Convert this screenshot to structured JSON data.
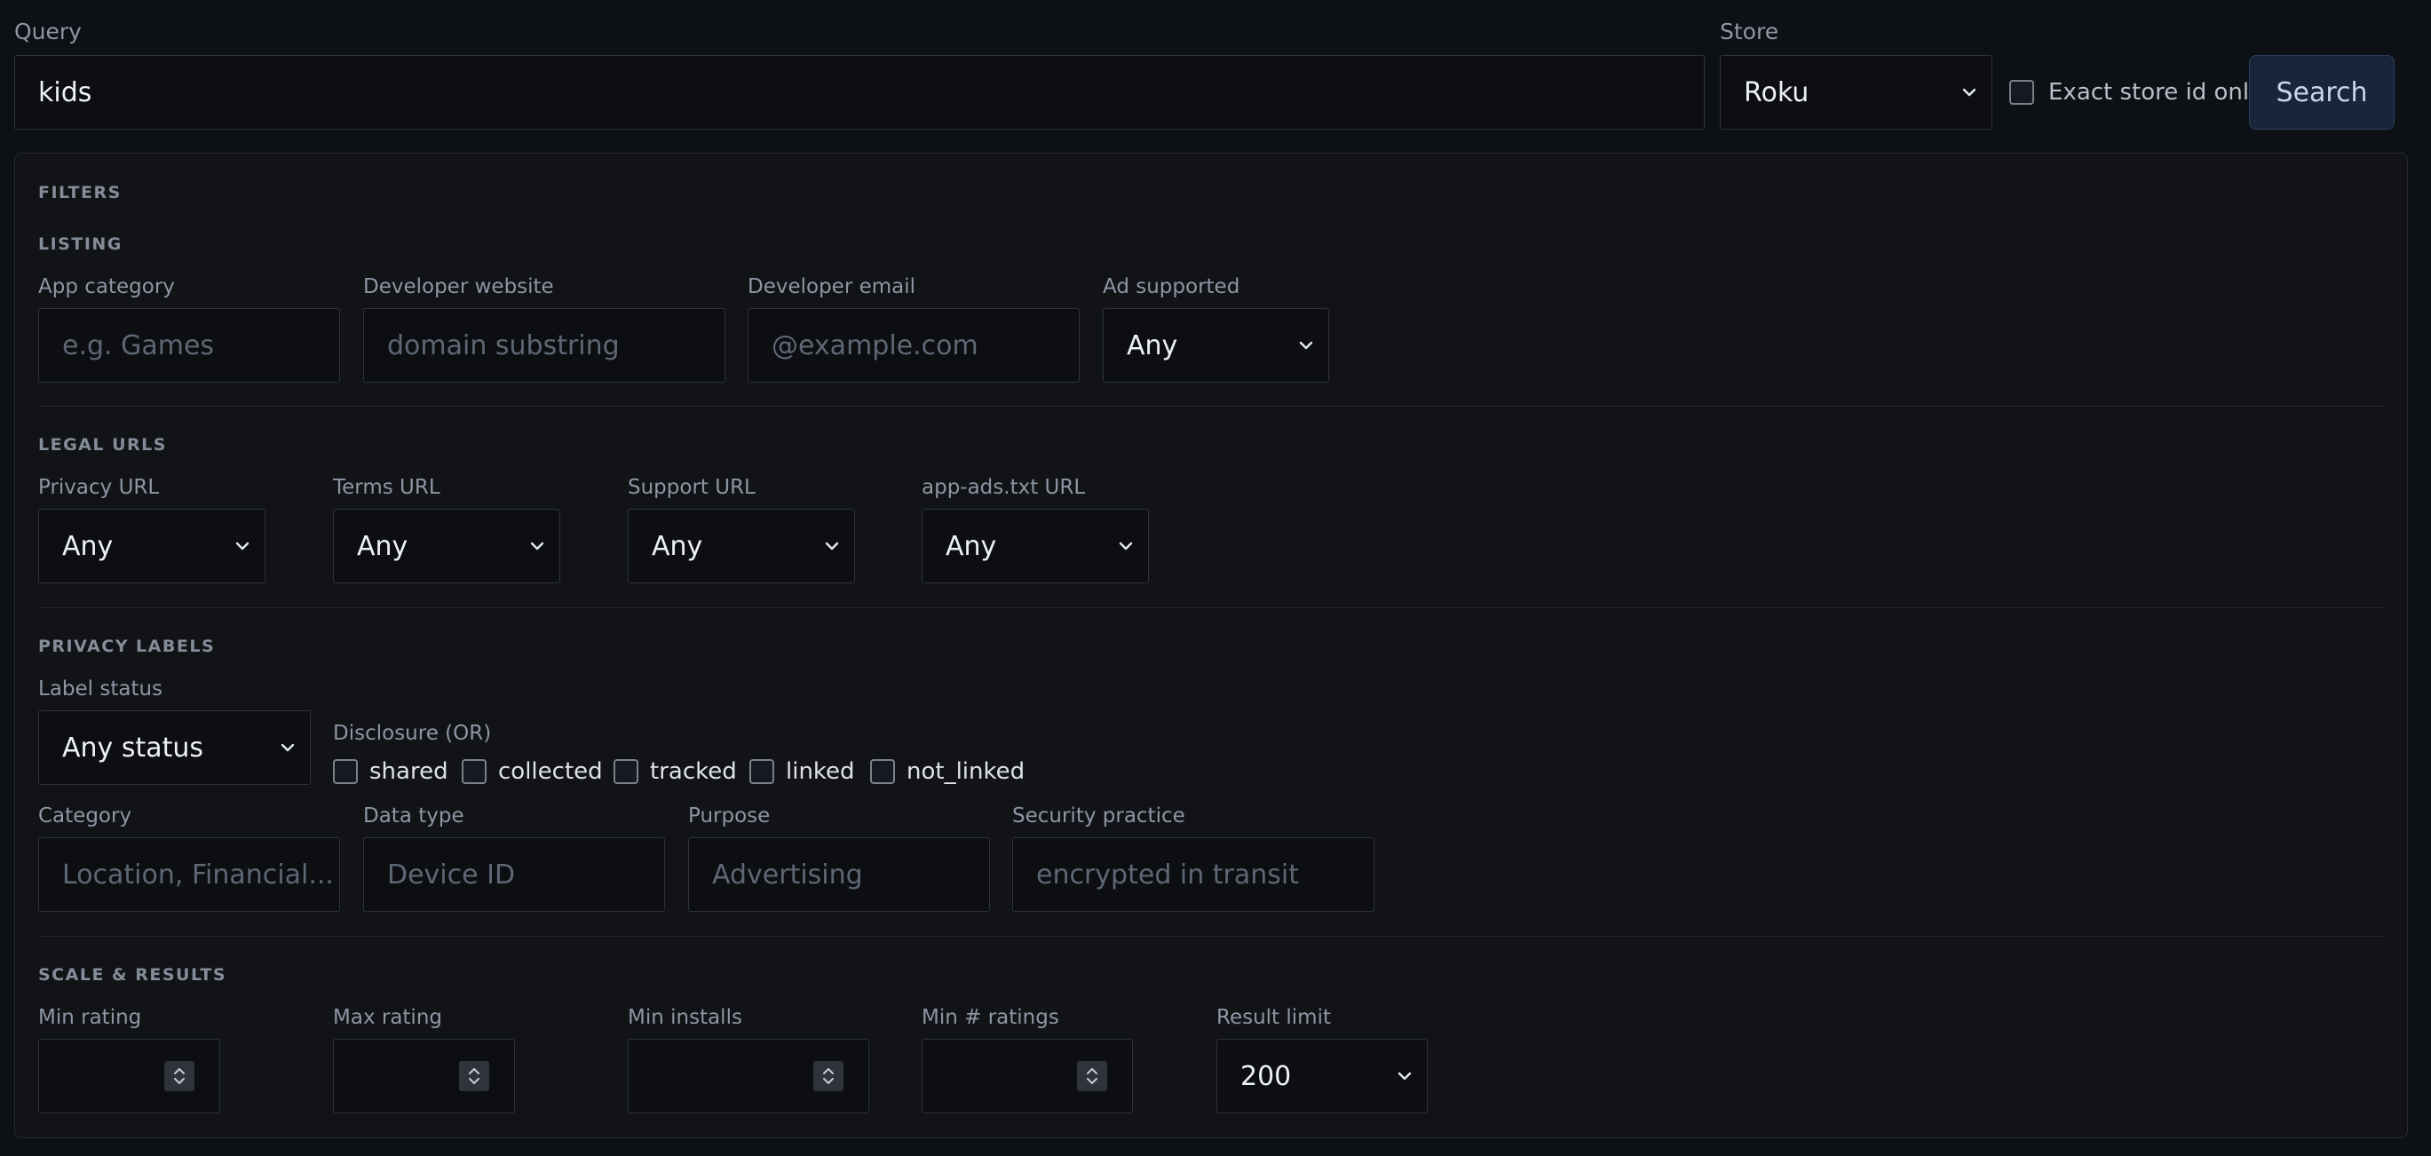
{
  "header": {
    "query_label": "Query",
    "query_value": "kids",
    "store_label": "Store",
    "store_value": "Roku",
    "exact_label": "Exact store id only",
    "search_label": "Search"
  },
  "filters": {
    "title": "FILTERS",
    "listing": {
      "title": "LISTING",
      "app_category": {
        "label": "App category",
        "placeholder": "e.g. Games"
      },
      "dev_website": {
        "label": "Developer website",
        "placeholder": "domain substring"
      },
      "dev_email": {
        "label": "Developer email",
        "placeholder": "@example.com"
      },
      "ad_supported": {
        "label": "Ad supported",
        "value": "Any"
      }
    },
    "legal": {
      "title": "LEGAL URLS",
      "privacy": {
        "label": "Privacy URL",
        "value": "Any"
      },
      "terms": {
        "label": "Terms URL",
        "value": "Any"
      },
      "support": {
        "label": "Support URL",
        "value": "Any"
      },
      "appads": {
        "label": "app-ads.txt URL",
        "value": "Any"
      }
    },
    "privacy": {
      "title": "PRIVACY LABELS",
      "status": {
        "label": "Label status",
        "value": "Any status"
      },
      "disclosure_label": "Disclosure (OR)",
      "disclosure_options": [
        "shared",
        "collected",
        "tracked",
        "linked",
        "not_linked"
      ],
      "category": {
        "label": "Category",
        "placeholder": "Location, Financial..."
      },
      "data_type": {
        "label": "Data type",
        "placeholder": "Device ID"
      },
      "purpose": {
        "label": "Purpose",
        "placeholder": "Advertising"
      },
      "security": {
        "label": "Security practice",
        "placeholder": "encrypted in transit"
      }
    },
    "scale": {
      "title": "SCALE & RESULTS",
      "min_rating": {
        "label": "Min rating"
      },
      "max_rating": {
        "label": "Max rating"
      },
      "min_installs": {
        "label": "Min installs"
      },
      "min_ratings": {
        "label": "Min # ratings"
      },
      "limit": {
        "label": "Result limit",
        "value": "200"
      }
    }
  },
  "colors": {
    "background": "#0d1015",
    "panel": "#111317",
    "accent": "#19253a"
  }
}
